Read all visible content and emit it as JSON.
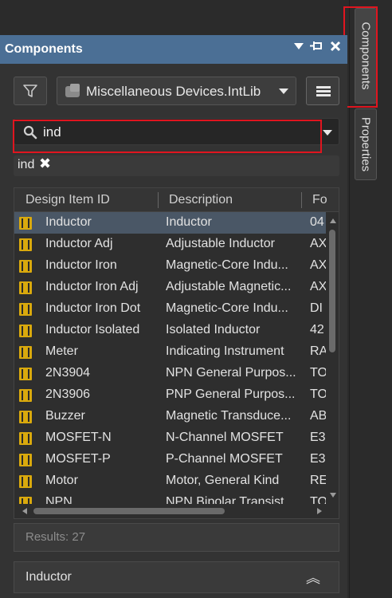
{
  "panel": {
    "title": "Components",
    "header_icons": [
      "dropdown-icon",
      "pin-icon",
      "close-icon"
    ]
  },
  "toolbar": {
    "library": "Miscellaneous Devices.IntLib"
  },
  "search": {
    "value": "ind"
  },
  "filter_chip": {
    "label": "ind",
    "remove_glyph": "✖"
  },
  "table": {
    "columns": [
      "Design Item ID",
      "Description",
      "Fo"
    ],
    "rows": [
      {
        "id": "Inductor",
        "description": "Inductor",
        "footprint": "04"
      },
      {
        "id": "Inductor Adj",
        "description": "Adjustable Inductor",
        "footprint": "AX"
      },
      {
        "id": "Inductor Iron",
        "description": "Magnetic-Core Indu...",
        "footprint": "AX"
      },
      {
        "id": "Inductor Iron Adj",
        "description": "Adjustable Magnetic...",
        "footprint": "AX"
      },
      {
        "id": "Inductor Iron Dot",
        "description": "Magnetic-Core Indu...",
        "footprint": "DI"
      },
      {
        "id": "Inductor Isolated",
        "description": "Isolated Inductor",
        "footprint": "42"
      },
      {
        "id": "Meter",
        "description": "Indicating Instrument",
        "footprint": "RA"
      },
      {
        "id": "2N3904",
        "description": "NPN General Purpos...",
        "footprint": "TO"
      },
      {
        "id": "2N3906",
        "description": "PNP General Purpos...",
        "footprint": "TO"
      },
      {
        "id": "Buzzer",
        "description": "Magnetic Transduce...",
        "footprint": "AB"
      },
      {
        "id": "MOSFET-N",
        "description": "N-Channel MOSFET",
        "footprint": "E3"
      },
      {
        "id": "MOSFET-P",
        "description": "P-Channel MOSFET",
        "footprint": "E3"
      },
      {
        "id": "Motor",
        "description": "Motor, General Kind",
        "footprint": "RE"
      },
      {
        "id": "NPN",
        "description": "NPN Bipolar Transist...",
        "footprint": "TO"
      }
    ],
    "selected_index": 0
  },
  "results": {
    "label": "Results: 27"
  },
  "details": {
    "title": "Inductor",
    "collapse_glyph": "︽"
  },
  "side_tabs": {
    "components": "Components",
    "properties": "Properties"
  },
  "colors": {
    "header": "#4b6f95",
    "highlight": "#e0151f",
    "selected_row": "#4a5766",
    "component_icon": "#d9a90d"
  }
}
